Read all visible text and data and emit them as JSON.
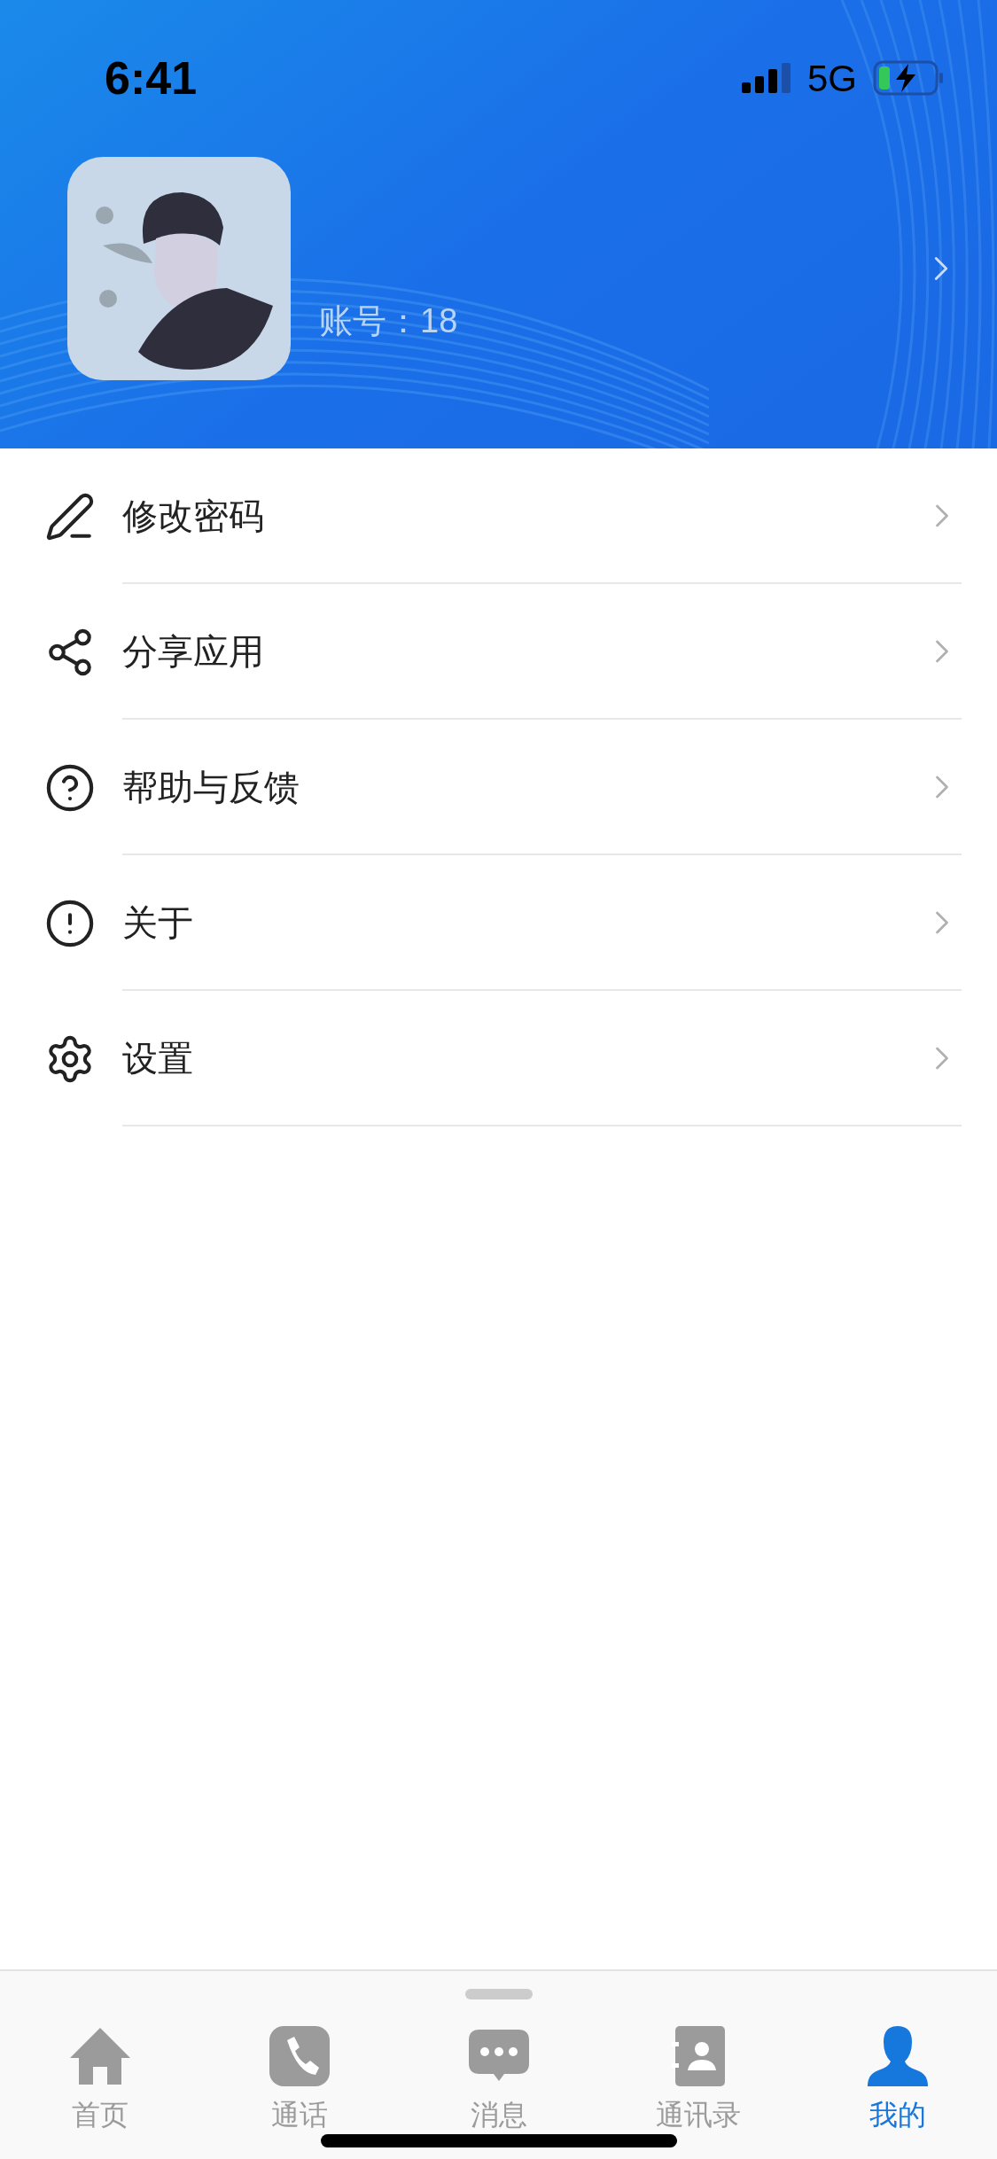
{
  "status_bar": {
    "time": "6:41",
    "network": "5G"
  },
  "profile": {
    "account": "账号：18"
  },
  "menu": [
    {
      "kind": "edit",
      "label": "修改密码"
    },
    {
      "kind": "share",
      "label": "分享应用"
    },
    {
      "kind": "help",
      "label": "帮助与反馈"
    },
    {
      "kind": "info",
      "label": "关于"
    },
    {
      "kind": "settings",
      "label": "设置"
    }
  ],
  "tab_bar": [
    {
      "kind": "home",
      "label": "首页",
      "selected": false
    },
    {
      "kind": "phone",
      "label": "通话",
      "selected": false
    },
    {
      "kind": "chat",
      "label": "消息",
      "selected": false
    },
    {
      "kind": "contacts",
      "label": "通讯录",
      "selected": false
    },
    {
      "kind": "user",
      "label": "我的",
      "selected": true
    }
  ]
}
